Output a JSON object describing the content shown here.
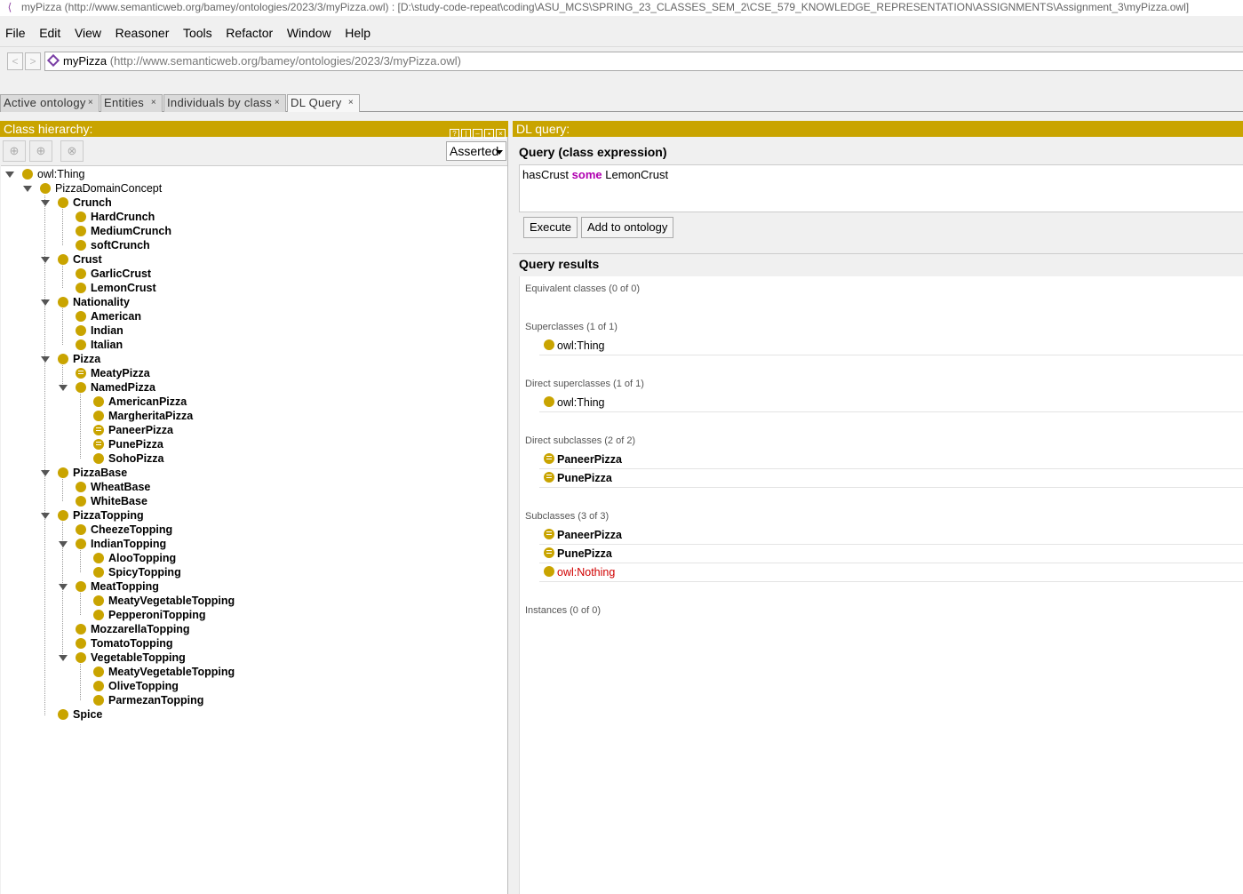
{
  "window": {
    "title": "myPizza (http://www.semanticweb.org/bamey/ontologies/2023/3/myPizza.owl)  : [D:\\study-code-repeat\\coding\\ASU_MCS\\SPRING_23_CLASSES_SEM_2\\CSE_579_KNOWLEDGE_REPRESENTATION\\ASSIGNMENTS\\Assignment_3\\myPizza.owl]"
  },
  "menu": [
    "File",
    "Edit",
    "View",
    "Reasoner",
    "Tools",
    "Refactor",
    "Window",
    "Help"
  ],
  "address": {
    "name": "myPizza",
    "uri": "(http://www.semanticweb.org/bamey/ontologies/2023/3/myPizza.owl)",
    "back": "<",
    "forward": ">"
  },
  "tabs": [
    {
      "label": "Active ontology"
    },
    {
      "label": "Entities"
    },
    {
      "label": "Individuals by class"
    },
    {
      "label": "DL Query"
    }
  ],
  "tab_close": "×",
  "left": {
    "title": "Class hierarchy:",
    "mode": "Asserted",
    "tree": [
      {
        "label": "owl:Thing",
        "bold": false
      },
      {
        "label": "PizzaDomainConcept",
        "bold": false
      },
      {
        "label": "Crunch",
        "bold": true
      },
      {
        "label": "HardCrunch",
        "bold": true
      },
      {
        "label": "MediumCrunch",
        "bold": true
      },
      {
        "label": "softCrunch",
        "bold": true
      },
      {
        "label": "Crust",
        "bold": true
      },
      {
        "label": "GarlicCrust",
        "bold": true
      },
      {
        "label": "LemonCrust",
        "bold": true
      },
      {
        "label": "Nationality",
        "bold": true
      },
      {
        "label": "American",
        "bold": true
      },
      {
        "label": "Indian",
        "bold": true
      },
      {
        "label": "Italian",
        "bold": true
      },
      {
        "label": "Pizza",
        "bold": true
      },
      {
        "label": "MeatyPizza",
        "bold": true
      },
      {
        "label": "NamedPizza",
        "bold": true
      },
      {
        "label": "AmericanPizza",
        "bold": true
      },
      {
        "label": "MargheritaPizza",
        "bold": true
      },
      {
        "label": "PaneerPizza",
        "bold": true
      },
      {
        "label": "PunePizza",
        "bold": true
      },
      {
        "label": "SohoPizza",
        "bold": true
      },
      {
        "label": "PizzaBase",
        "bold": true
      },
      {
        "label": "WheatBase",
        "bold": true
      },
      {
        "label": "WhiteBase",
        "bold": true
      },
      {
        "label": "PizzaTopping",
        "bold": true
      },
      {
        "label": "CheezeTopping",
        "bold": true
      },
      {
        "label": "IndianTopping",
        "bold": true
      },
      {
        "label": "AlooTopping",
        "bold": true
      },
      {
        "label": "SpicyTopping",
        "bold": true
      },
      {
        "label": "MeatTopping",
        "bold": true
      },
      {
        "label": "MeatyVegetableTopping",
        "bold": true
      },
      {
        "label": "PepperoniTopping",
        "bold": true
      },
      {
        "label": "MozzarellaTopping",
        "bold": true
      },
      {
        "label": "TomatoTopping",
        "bold": true
      },
      {
        "label": "VegetableTopping",
        "bold": true
      },
      {
        "label": "MeatyVegetableTopping",
        "bold": true
      },
      {
        "label": "OliveTopping",
        "bold": true
      },
      {
        "label": "ParmezanTopping",
        "bold": true
      },
      {
        "label": "Spice",
        "bold": true
      }
    ]
  },
  "right": {
    "title": "DL query:",
    "query_heading": "Query (class expression)",
    "query": {
      "part1": "hasCrust",
      "keyword": "some",
      "part2": "LemonCrust"
    },
    "execute": "Execute",
    "add": "Add to ontology",
    "results_heading": "Query results",
    "groups": [
      {
        "label": "Equivalent classes (0 of 0)",
        "items": []
      },
      {
        "label": "Superclasses (1 of 1)",
        "items": [
          {
            "label": "owl:Thing",
            "style": "normal"
          }
        ]
      },
      {
        "label": "Direct superclasses (1 of 1)",
        "items": [
          {
            "label": "owl:Thing",
            "style": "normal"
          }
        ]
      },
      {
        "label": "Direct subclasses (2 of 2)",
        "items": [
          {
            "label": "PaneerPizza",
            "style": "bold"
          },
          {
            "label": "PunePizza",
            "style": "bold"
          }
        ]
      },
      {
        "label": "Subclasses (3 of 3)",
        "items": [
          {
            "label": "PaneerPizza",
            "style": "bold"
          },
          {
            "label": "PunePizza",
            "style": "bold"
          },
          {
            "label": "owl:Nothing",
            "style": "red"
          }
        ]
      },
      {
        "label": "Instances (0 of 0)",
        "items": []
      }
    ]
  },
  "colors": {
    "header": "#c9a400",
    "class_bullet": "#c9a400",
    "keyword": "#b000b0",
    "nothing": "#d00000"
  }
}
